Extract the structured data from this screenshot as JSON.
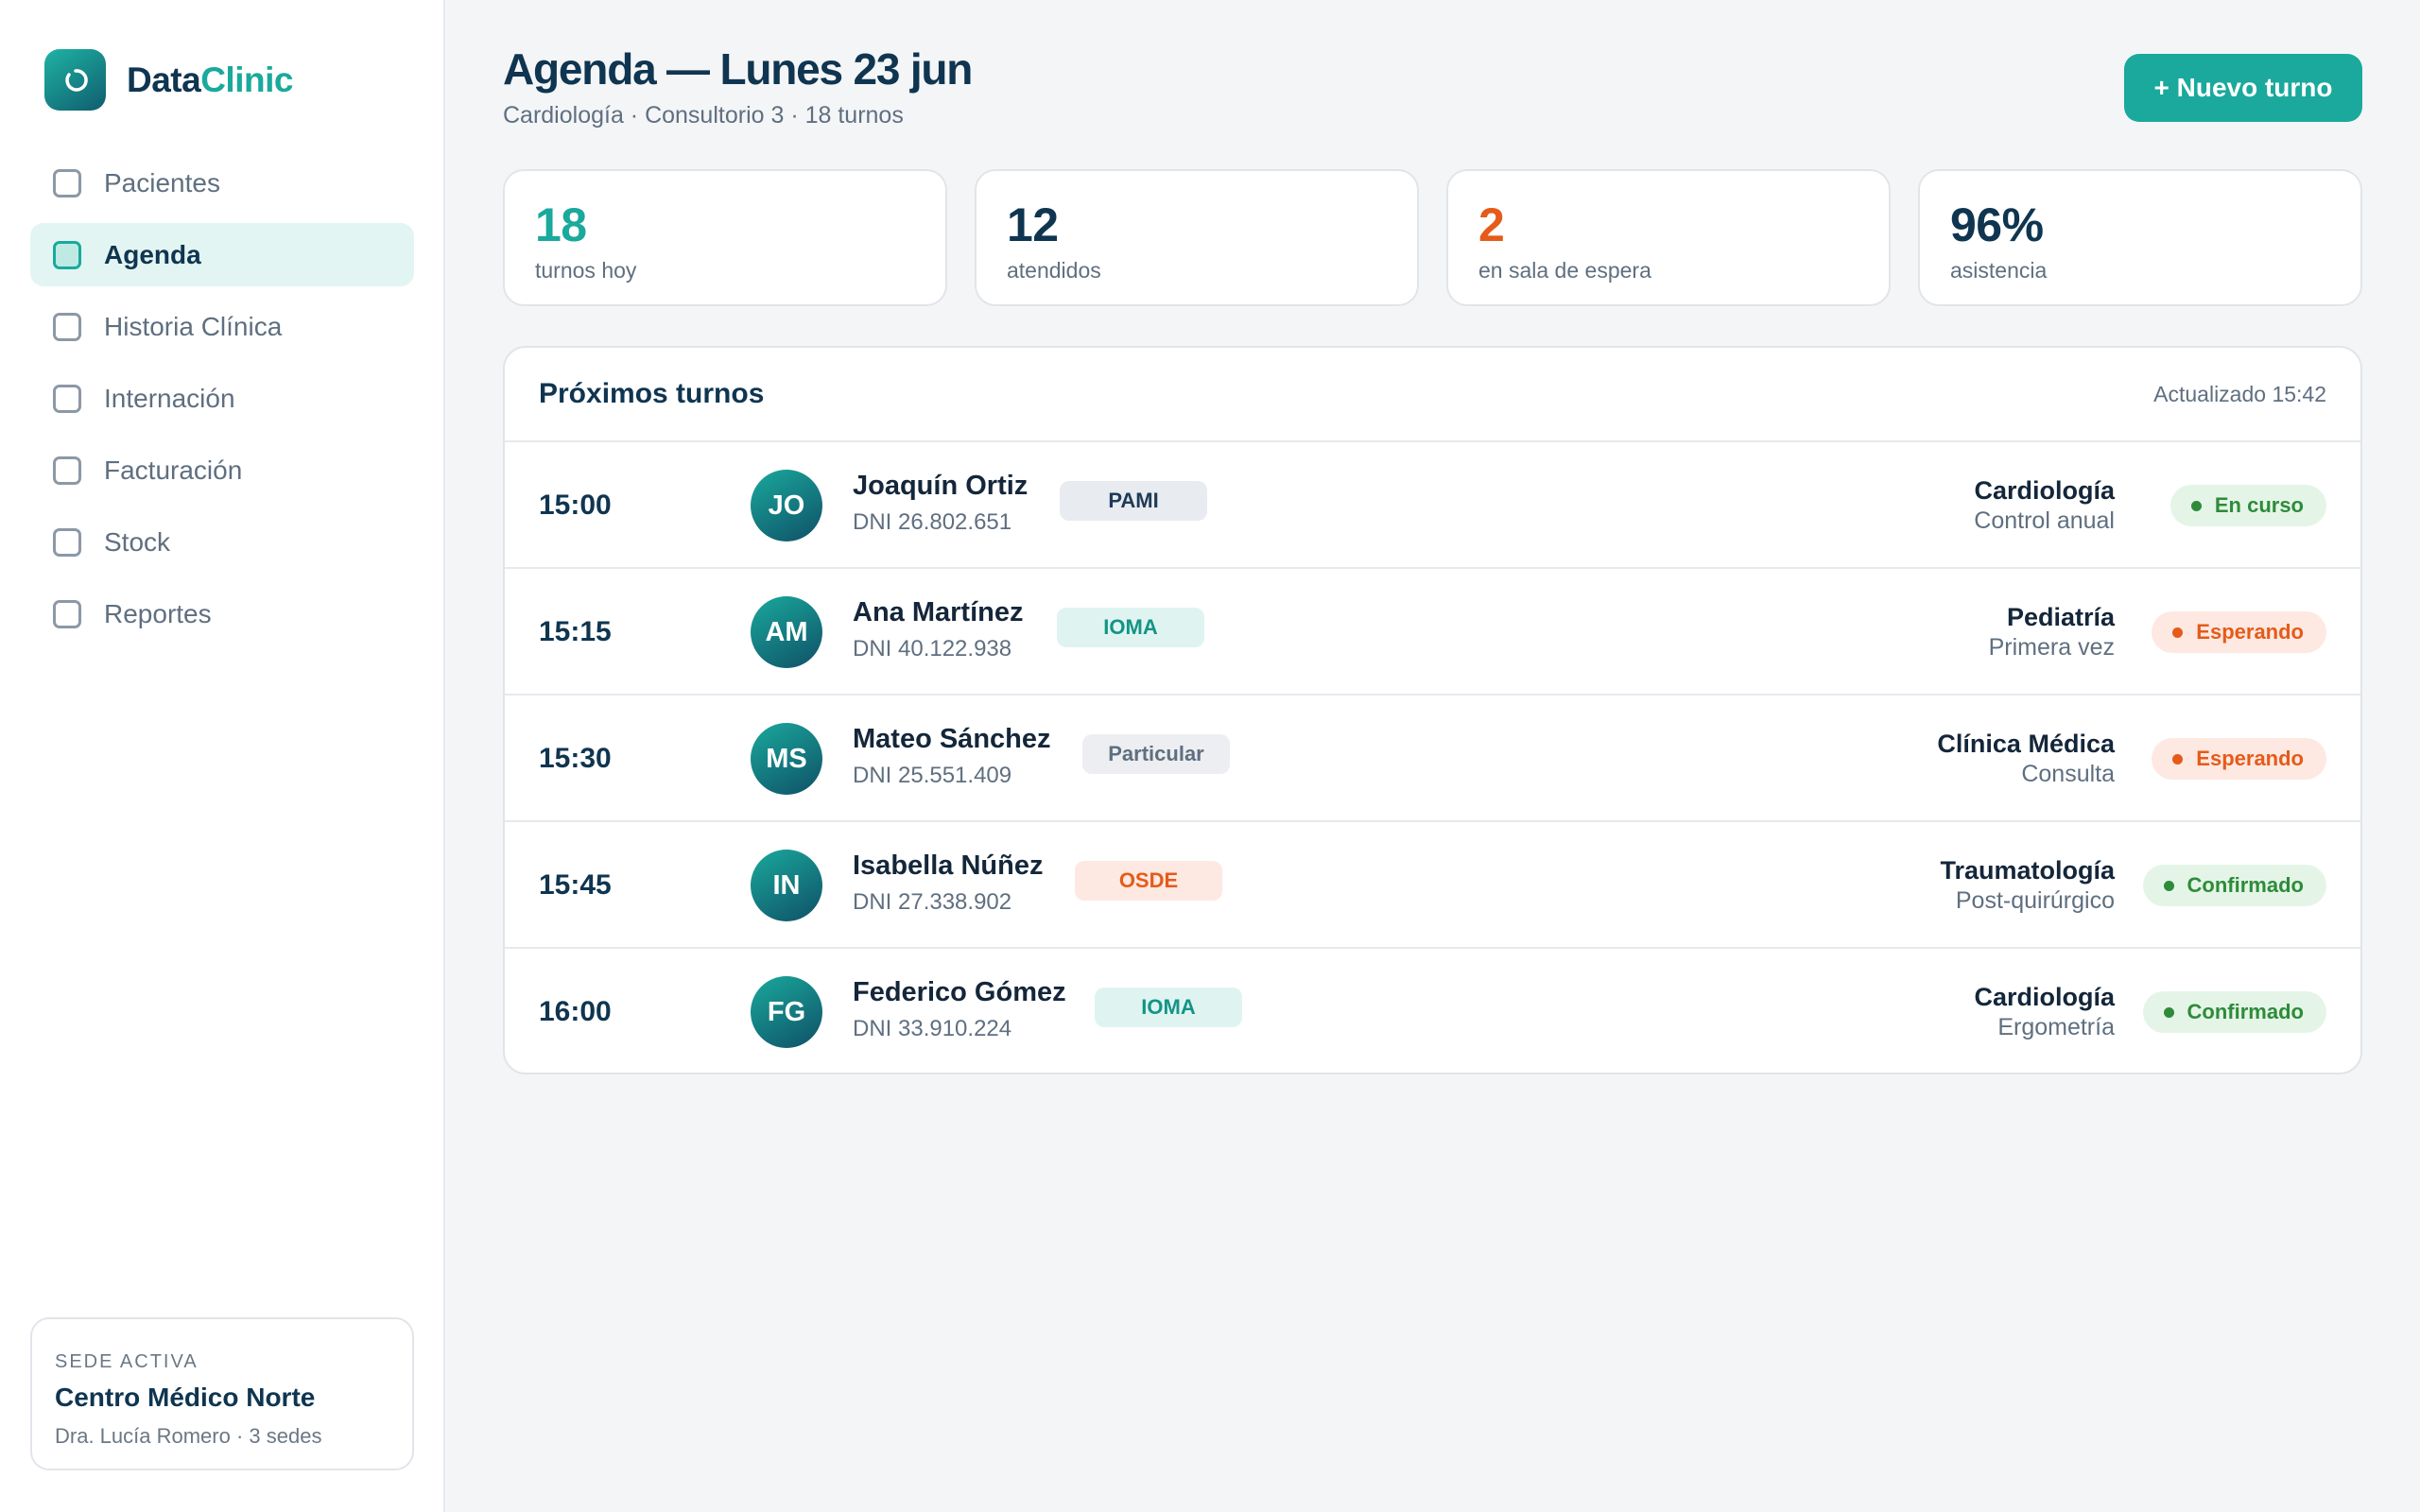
{
  "brand": {
    "name_part1": "Data",
    "name_part2": "Clinic",
    "logo_icon": "refresh-arc-icon"
  },
  "nav": [
    {
      "label": "Pacientes",
      "active": false
    },
    {
      "label": "Agenda",
      "active": true
    },
    {
      "label": "Historia Clínica",
      "active": false
    },
    {
      "label": "Internación",
      "active": false
    },
    {
      "label": "Facturación",
      "active": false
    },
    {
      "label": "Stock",
      "active": false
    },
    {
      "label": "Reportes",
      "active": false
    }
  ],
  "site": {
    "label": "SEDE ACTIVA",
    "name": "Centro Médico Norte",
    "sub": "Dra. Lucía Romero · 3 sedes"
  },
  "header": {
    "title": "Agenda — Lunes 23 jun",
    "subtitle": "Cardiología · Consultorio 3 · 18 turnos",
    "new_button": "+ Nuevo turno"
  },
  "stats": [
    {
      "value": "18",
      "label": "turnos hoy",
      "color": "#1aa99c"
    },
    {
      "value": "12",
      "label": "atendidos",
      "color": "#0f3550"
    },
    {
      "value": "2",
      "label": "en sala de espera",
      "color": "#e65a1a"
    },
    {
      "value": "96%",
      "label": "asistencia",
      "color": "#0f3550"
    }
  ],
  "panel": {
    "title": "Próximos turnos",
    "updated": "Actualizado 15:42",
    "rows": [
      {
        "time": "15:00",
        "initials": "JO",
        "name": "Joaquín Ortiz",
        "dni": "DNI 26.802.651",
        "insurance": "PAMI",
        "insurance_style": "gray",
        "specialty": "Cardiología",
        "detail": "Control anual",
        "status": "En curso",
        "status_style": "green"
      },
      {
        "time": "15:15",
        "initials": "AM",
        "name": "Ana Martínez",
        "dni": "DNI 40.122.938",
        "insurance": "IOMA",
        "insurance_style": "teal",
        "specialty": "Pediatría",
        "detail": "Primera vez",
        "status": "Esperando",
        "status_style": "orange"
      },
      {
        "time": "15:30",
        "initials": "MS",
        "name": "Mateo Sánchez",
        "dni": "DNI 25.551.409",
        "insurance": "Particular",
        "insurance_style": "light",
        "specialty": "Clínica Médica",
        "detail": "Consulta",
        "status": "Esperando",
        "status_style": "orange"
      },
      {
        "time": "15:45",
        "initials": "IN",
        "name": "Isabella Núñez",
        "dni": "DNI 27.338.902",
        "insurance": "OSDE",
        "insurance_style": "orange",
        "specialty": "Traumatología",
        "detail": "Post-quirúrgico",
        "status": "Confirmado",
        "status_style": "green"
      },
      {
        "time": "16:00",
        "initials": "FG",
        "name": "Federico Gómez",
        "dni": "DNI 33.910.224",
        "insurance": "IOMA",
        "insurance_style": "teal",
        "specialty": "Cardiología",
        "detail": "Ergometría",
        "status": "Confirmado",
        "status_style": "green"
      }
    ]
  }
}
